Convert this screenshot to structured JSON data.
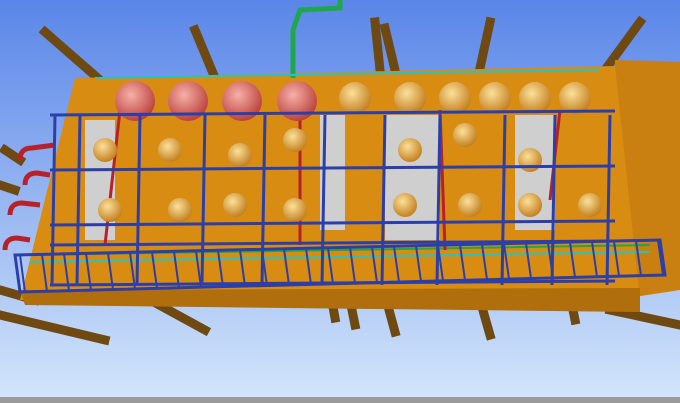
{
  "scene": {
    "colors": {
      "sky_top": "#5a86e8",
      "sky_bottom": "#d4e6fb",
      "deck": "#d98c12",
      "deck_shadow": "#a86a0c",
      "beam": "#6e4a12",
      "frame": "#2c3fa8",
      "tank_red": "#d9574f",
      "tank_orange": "#e4a03a",
      "pipe_green": "#1fa84a",
      "pipe_cyan": "#27c3c3",
      "pipe_red": "#b8202a",
      "floor_grey": "#cfcfcf"
    }
  }
}
